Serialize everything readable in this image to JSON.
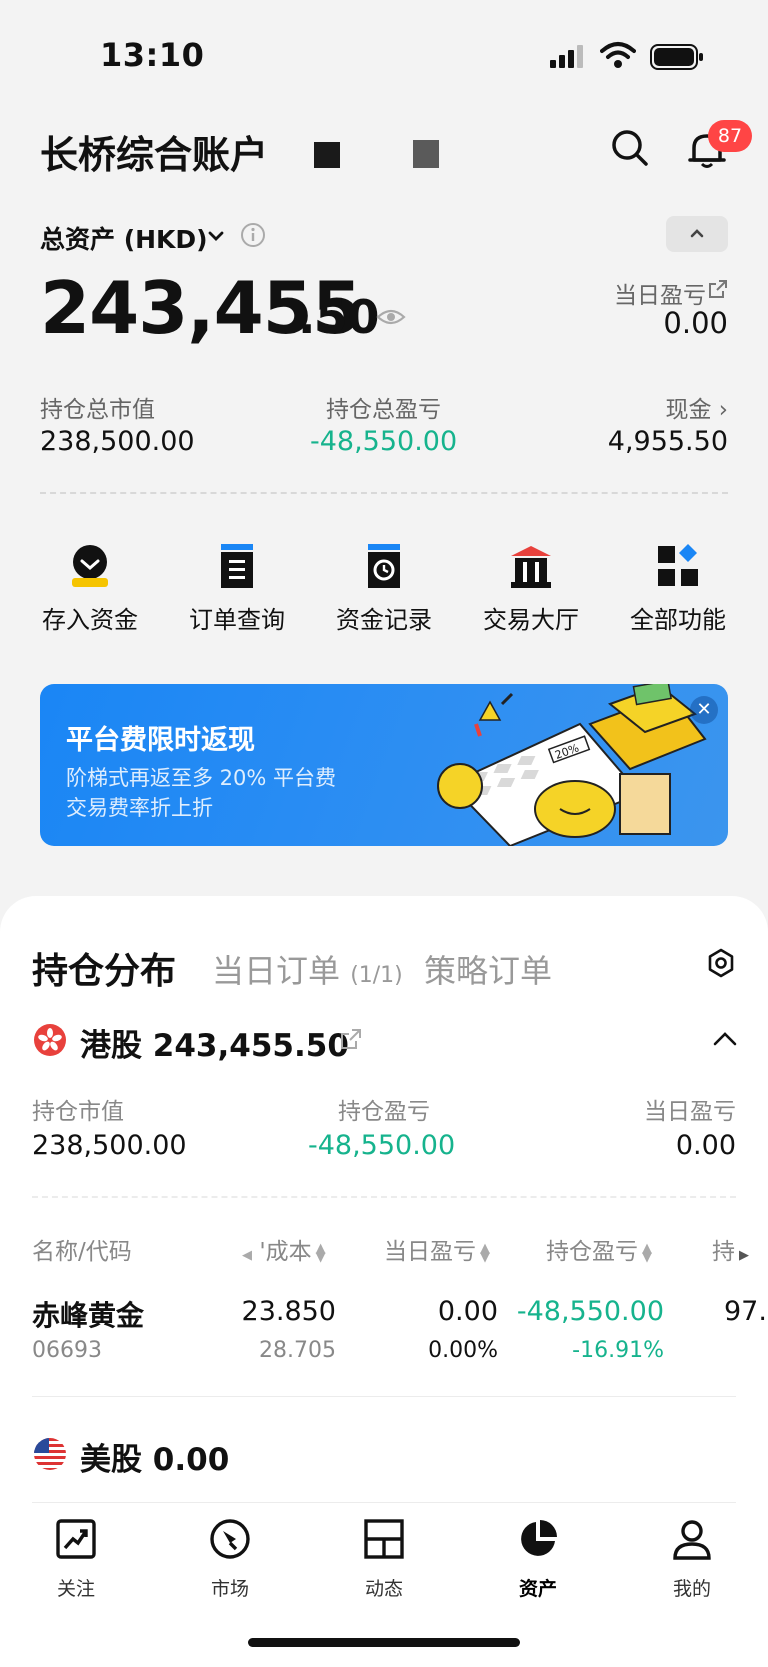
{
  "status_bar": {
    "time": "13:10"
  },
  "header": {
    "account_title": "长桥综合账户",
    "notification_count": "87"
  },
  "total_assets": {
    "label": "总资产 (HKD)",
    "value_int": "243,455",
    "value_dec": ".50",
    "day_pl_label": "当日盈亏",
    "day_pl_value": "0.00"
  },
  "summary": {
    "holding_mv_label": "持仓总市值",
    "holding_mv_value": "238,500.00",
    "holding_pl_label": "持仓总盈亏",
    "holding_pl_value": "-48,550.00",
    "cash_label": "现金 ›",
    "cash_value": "4,955.50"
  },
  "quick_functions": [
    {
      "label": "存入资金",
      "icon": "deposit-icon"
    },
    {
      "label": "订单查询",
      "icon": "order-query-icon"
    },
    {
      "label": "资金记录",
      "icon": "fund-record-icon"
    },
    {
      "label": "交易大厅",
      "icon": "trading-hall-icon"
    },
    {
      "label": "全部功能",
      "icon": "all-functions-icon"
    }
  ],
  "banner": {
    "title": "平台费限时返现",
    "line1": "阶梯式再返至多 20% 平台费",
    "line2": "交易费率折上折",
    "art_text": "20%"
  },
  "sheet_tabs": {
    "holdings": "持仓分布",
    "day_orders": "当日订单",
    "day_orders_count": "(1/1)",
    "strategy_orders": "策略订单"
  },
  "hk_market": {
    "title": "港股 243,455.50",
    "mv_label": "持仓市值",
    "mv_value": "238,500.00",
    "pl_label": "持仓盈亏",
    "pl_value": "-48,550.00",
    "day_label": "当日盈亏",
    "day_value": "0.00"
  },
  "table": {
    "headers": [
      "名称/代码",
      "'成本",
      "当日盈亏",
      "持仓盈亏",
      "持"
    ],
    "rows": [
      {
        "name": "赤峰黄金",
        "code": "06693",
        "price": "23.850",
        "cost": "28.705",
        "day_pl": "0.00",
        "day_pl_pct": "0.00%",
        "pl": "-48,550.00",
        "pl_pct": "-16.91%",
        "extra": "97."
      }
    ]
  },
  "us_market": {
    "title": "美股 0.00"
  },
  "tab_bar": [
    {
      "label": "关注",
      "icon": "watchlist-icon"
    },
    {
      "label": "市场",
      "icon": "market-icon"
    },
    {
      "label": "动态",
      "icon": "feed-icon"
    },
    {
      "label": "资产",
      "icon": "assets-icon"
    },
    {
      "label": "我的",
      "icon": "profile-icon"
    }
  ],
  "colors": {
    "profit_down": "#16b38d",
    "banner_blue": "#1a86f5",
    "badge_red": "#ff4545"
  }
}
